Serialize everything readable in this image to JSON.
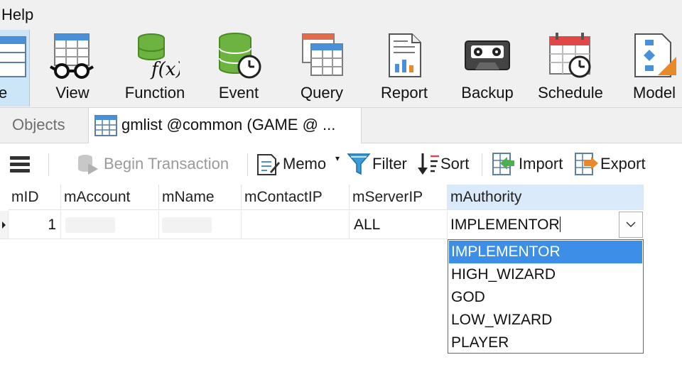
{
  "menu": {
    "help": "Help"
  },
  "ribbon": {
    "table_partial": "e",
    "buttons": [
      {
        "id": "view",
        "label": "View",
        "icon": "view-icon"
      },
      {
        "id": "function",
        "label": "Function",
        "icon": "function-icon"
      },
      {
        "id": "event",
        "label": "Event",
        "icon": "event-icon"
      },
      {
        "id": "query",
        "label": "Query",
        "icon": "query-icon"
      },
      {
        "id": "report",
        "label": "Report",
        "icon": "report-icon"
      },
      {
        "id": "backup",
        "label": "Backup",
        "icon": "backup-icon"
      },
      {
        "id": "schedule",
        "label": "Schedule",
        "icon": "schedule-icon"
      },
      {
        "id": "model",
        "label": "Model",
        "icon": "model-icon"
      }
    ]
  },
  "tabs": {
    "objects": "Objects",
    "active": "gmlist @common (GAME @ ..."
  },
  "toolbar": {
    "begin_transaction": "Begin Transaction",
    "memo": "Memo",
    "filter": "Filter",
    "sort": "Sort",
    "import": "Import",
    "export": "Export"
  },
  "grid": {
    "columns": [
      "mID",
      "mAccount",
      "mName",
      "mContactIP",
      "mServerIP",
      "mAuthority"
    ],
    "row": {
      "mID": "1",
      "mAccount": "",
      "mName": "",
      "mContactIP": "",
      "mServerIP": "ALL",
      "mAuthority": "IMPLEMENTOR"
    }
  },
  "dropdown": {
    "options": [
      "IMPLEMENTOR",
      "HIGH_WIZARD",
      "GOD",
      "LOW_WIZARD",
      "PLAYER"
    ],
    "selected": "IMPLEMENTOR"
  },
  "colors": {
    "selection": "#3d8ee6",
    "ribbon_bg": "#f0f0f0",
    "active_header": "#dbeafa"
  }
}
